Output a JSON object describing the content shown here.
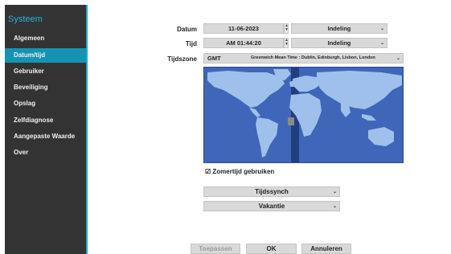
{
  "sidebar": {
    "title": "Systeem",
    "items": [
      {
        "label": "Algemeen"
      },
      {
        "label": "Datum/tijd",
        "active": true
      },
      {
        "label": "Gebruiker"
      },
      {
        "label": "Beveiliging"
      },
      {
        "label": "Opslag"
      },
      {
        "label": "Zelfdiagnose"
      },
      {
        "label": "Aangepaste Waarde"
      },
      {
        "label": "Over"
      }
    ]
  },
  "form": {
    "date_label": "Datum",
    "date_value": "11-06-2023",
    "date_format": "Indeling",
    "time_label": "Tijd",
    "time_value": "AM 01:44:20",
    "time_format": "Indeling",
    "timezone_label": "Tijdszone",
    "timezone_code": "GMT",
    "timezone_name": "Greenwich Mean Time : Dublin, Edinburgh, Lisbon, London",
    "dst_label": "Zomertijd gebruiken",
    "dst_checked": true
  },
  "buttons": {
    "sync": "Tijdssynch",
    "holiday": "Vakantie",
    "apply": "Toepassen",
    "ok": "OK",
    "cancel": "Annuleren"
  },
  "colors": {
    "accent": "#1fa9c8",
    "sidebar_bg": "#333333",
    "map_ocean": "#3f66b8",
    "map_land": "#9ec0ea",
    "timezone_band": "#1f3f80"
  }
}
